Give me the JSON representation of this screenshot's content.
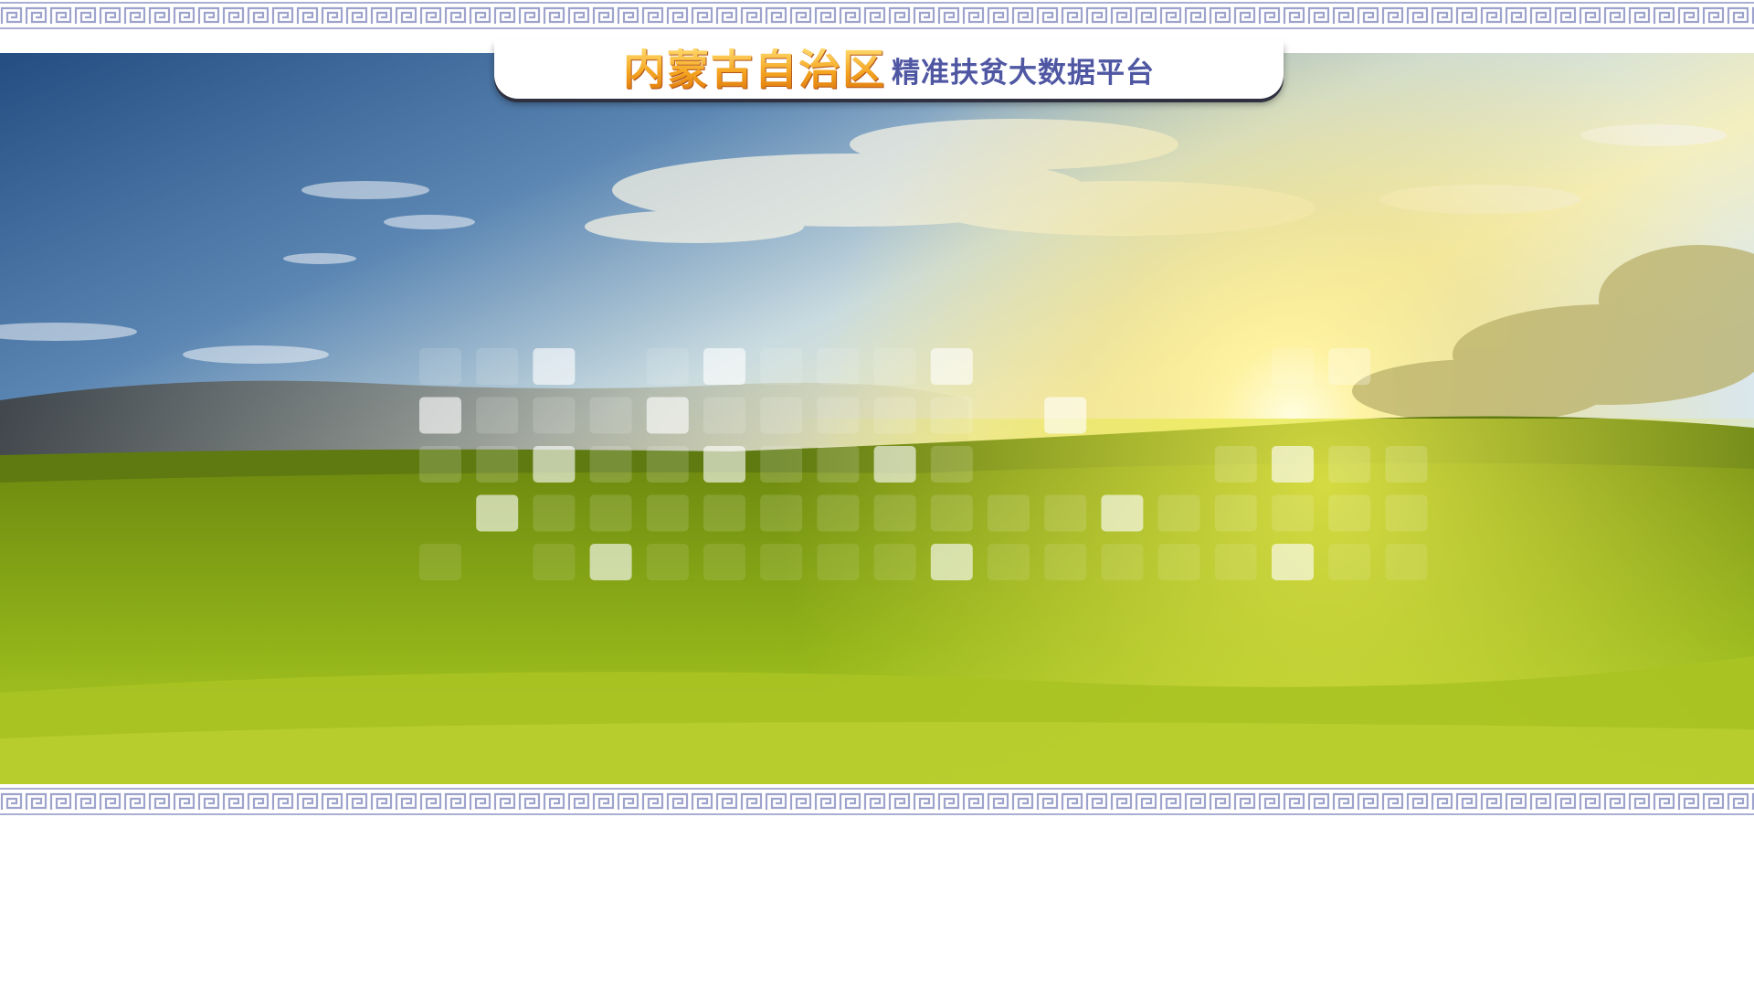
{
  "header": {
    "title_region": "内蒙古自治区",
    "title_platform": "精准扶贫大数据平台"
  },
  "banner": {
    "scene": "grassland-sunrise",
    "colors": {
      "sky_top": "#2c5b8f",
      "sky_mid": "#8fb3cf",
      "sun_glow": "#fff6b0",
      "grass_far": "#7a9a12",
      "grass_near": "#a8c51c"
    }
  },
  "decoration": {
    "border_pattern": "greek-key",
    "border_color": "#9ea3cc",
    "tile_pattern_color": "#ffffff"
  }
}
